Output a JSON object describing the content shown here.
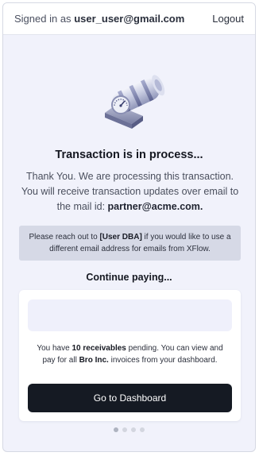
{
  "header": {
    "signed_in_prefix": "Signed in as",
    "user_email": "user_user@gmail.com",
    "logout_label": "Logout"
  },
  "status": {
    "title": "Transaction is in process...",
    "message_part1": "Thank You. We are processing this transaction. You will receive transaction updates over email to the mail id: ",
    "email": "partner@acme.com."
  },
  "notice": {
    "prefix": "Please reach out to ",
    "contact": "[User DBA]",
    "suffix": " if you would like to use a different email address for emails from XFlow."
  },
  "continue_heading": "Continue paying...",
  "card": {
    "text_prefix": "You have ",
    "receivables": "10 receivables",
    "text_middle": " pending. You can view and pay for all ",
    "company": "Bro Inc.",
    "text_suffix": " invoices from your dashboard.",
    "cta_label": "Go to Dashboard"
  },
  "pagination": {
    "total": 4,
    "active_index": 0
  },
  "colors": {
    "background": "#f1f2fb",
    "notice_bg": "#d6d9e6",
    "cta_bg": "#151a23"
  },
  "icons": {
    "hero": "server-gauge-illustration"
  }
}
